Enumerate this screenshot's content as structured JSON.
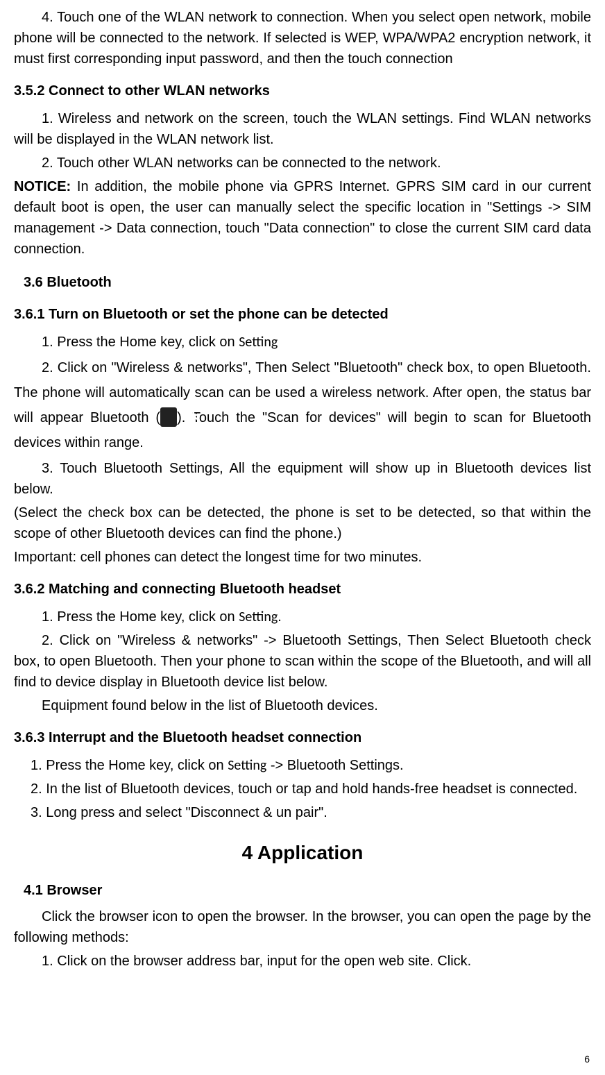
{
  "p1": "4. Touch one of the WLAN network to connection. When you select open network, mobile phone will be connected to the network. If selected is WEP, WPA/WPA2 encryption network, it must first corresponding input password, and then the touch connection",
  "h352": "3.5.2    Connect to other WLAN networks",
  "p352_1": "1. Wireless and network on the screen, touch the WLAN settings. Find WLAN networks will be displayed in the WLAN network list.",
  "p352_2": "2. Touch other WLAN networks can be connected to the network.",
  "notice_label": "NOTICE:",
  "notice_text": " In addition, the mobile phone via GPRS Internet. GPRS SIM card in our current default boot is open, the user can manually select the specific location in \"Settings -> SIM management -> Data connection, touch \"Data connection\" to close the current SIM card data connection.",
  "h36": "3.6    Bluetooth",
  "h361": "3.6.1    Turn on Bluetooth or set the phone can be detected",
  "p361_1a": "1. Press the Home key, click on ",
  "setting_label": "Setting",
  "p361_2": "2. Click on \"Wireless & networks\", Then Select \"Bluetooth\" check box, to open Bluetooth. The phone will automatically scan can be used a wireless network. After open, the status bar will appear Bluetooth (",
  "p361_2b": "). Touch the \"Scan for devices\" will begin to scan for Bluetooth devices within range.",
  "p361_3": "3. Touch Bluetooth Settings, All the equipment will show up in Bluetooth devices list below.",
  "p361_4": "(Select the check box can be detected, the phone is set to be detected, so that within the scope of other Bluetooth devices can find the phone.)",
  "p361_5": "Important: cell phones can detect the longest time for two minutes.",
  "h362": "3.6.2    Matching and connecting Bluetooth headset",
  "p362_1a": "1. Press the Home key, click on ",
  "p362_1b": ".",
  "p362_2": "2. Click on \"Wireless & networks\" -> Bluetooth Settings, Then Select Bluetooth check box, to open Bluetooth. Then your phone to scan within the scope of the Bluetooth, and will all find to device display in Bluetooth device list below.",
  "p362_3": "Equipment found below in the list of Bluetooth devices.",
  "h363": "3.6.3    Interrupt and the Bluetooth headset connection",
  "p363_1a": "1. Press the Home key, click on ",
  "p363_1b": " -> Bluetooth Settings.",
  "p363_2": "2. In the list of Bluetooth devices, touch or tap and hold hands-free headset is connected.",
  "p363_3": "3. Long press and select \"Disconnect & un pair\".",
  "h4title": "4   Application",
  "h41": "4.1    Browser",
  "p41_1": "Click the browser icon to open the browser. In the browser, you can open the page by the following methods:",
  "p41_2": "1. Click on the browser address bar, input for the open web site. Click.",
  "page_number": "6",
  "bt_glyph": "✱"
}
